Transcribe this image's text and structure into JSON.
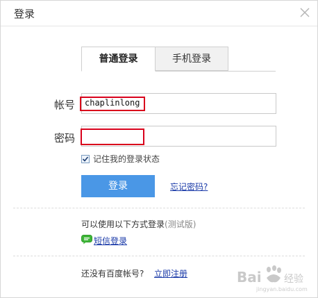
{
  "dialog": {
    "title": "登录"
  },
  "tabs": [
    {
      "label": "普通登录",
      "active": true
    },
    {
      "label": "手机登录",
      "active": false
    }
  ],
  "form": {
    "account_label": "帐号",
    "account_value": "chaplinlong",
    "password_label": "密码",
    "password_value": "",
    "remember_label": "记住我的登录状态",
    "remember_checked": true,
    "login_button": "登录",
    "forgot_link": "忘记密码?"
  },
  "alt_login": {
    "heading": "可以使用以下方式登录",
    "heading_note": "(测试版)",
    "sms_link": "短信登录",
    "sms_icon": "sms-bubble-icon"
  },
  "footer": {
    "no_account_text": "还没有百度帐号?",
    "register_link": "立即注册"
  },
  "annotation": {
    "highlight_color": "#d9001b"
  },
  "colors": {
    "primary_button": "#4a97e6",
    "link": "#1a3aa8"
  },
  "watermark": {
    "text": "Bai 经验"
  }
}
